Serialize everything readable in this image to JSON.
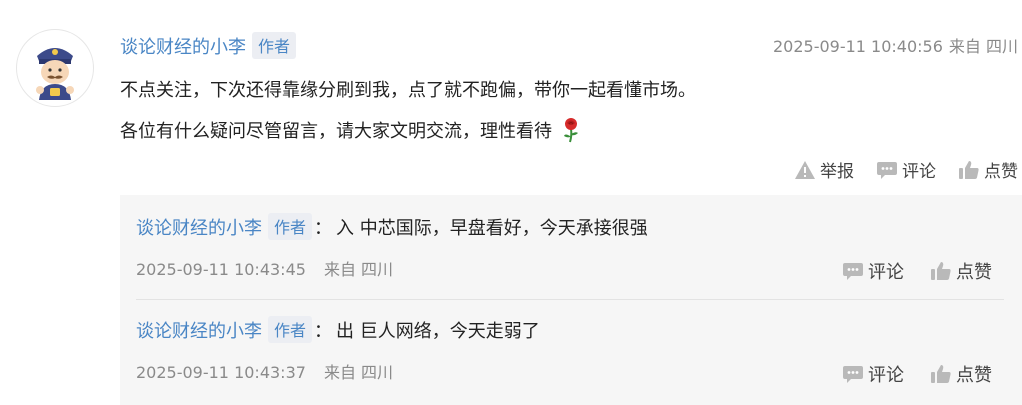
{
  "comment": {
    "author": "谈论财经的小李",
    "author_tag": "作者",
    "timestamp": "2025-09-11 10:40:56",
    "location": "来自 四川",
    "line1": "不点关注，下次还得靠缘分刷到我，点了就不跑偏，带你一起看懂市场。",
    "line2": "各位有什么疑问尽管留言，请大家文明交流，理性看待",
    "emoji": "rose-icon",
    "actions": {
      "report": "举报",
      "comment": "评论",
      "like": "点赞"
    }
  },
  "replies": [
    {
      "author": "谈论财经的小李",
      "tag": "作者",
      "colon": "：",
      "text": "入 中芯国际，早盘看好，今天承接很强",
      "timestamp": "2025-09-11 10:43:45",
      "location": "来自 四川",
      "comment_label": "评论",
      "like_label": "点赞"
    },
    {
      "author": "谈论财经的小李",
      "tag": "作者",
      "colon": "：",
      "text": "出 巨人网络，今天走弱了",
      "timestamp": "2025-09-11 10:43:37",
      "location": "来自 四川",
      "comment_label": "评论",
      "like_label": "点赞"
    }
  ],
  "colors": {
    "link_blue": "#4a86c5",
    "meta_gray": "#8a8a8a",
    "reply_bg": "#f6f6f6",
    "tag_bg": "#eceef3"
  }
}
